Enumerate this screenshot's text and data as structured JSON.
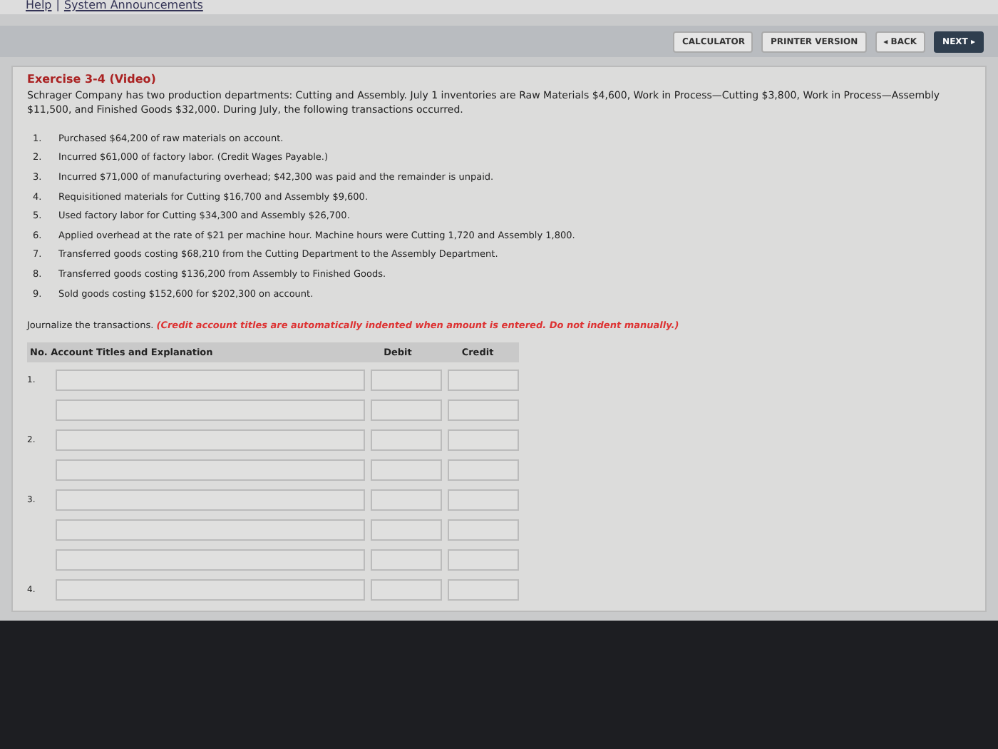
{
  "top_links": [
    "Help",
    "System Announcements"
  ],
  "top_links_separator": "|",
  "toolbar_buttons": [
    {
      "label": "CALCULATOR",
      "kind": "plain"
    },
    {
      "label": "PRINTER VERSION",
      "kind": "plain"
    },
    {
      "label": "◂ BACK",
      "kind": "plain"
    },
    {
      "label": "NEXT ▸",
      "kind": "primary"
    }
  ],
  "exercise": {
    "title": "Exercise 3-4 (Video)",
    "intro": "Schrager Company has two production departments: Cutting and Assembly. July 1 inventories are Raw Materials $4,600, Work in Process—Cutting $3,800, Work in Process—Assembly $11,500, and Finished Goods $32,000. During July, the following transactions occurred.",
    "transactions": [
      {
        "number": "1.",
        "text": "Purchased $64,200 of raw materials on account."
      },
      {
        "number": "2.",
        "text": "Incurred $61,000 of factory labor. (Credit Wages Payable.)"
      },
      {
        "number": "3.",
        "text": "Incurred $71,000 of manufacturing overhead; $42,300 was paid and the remainder is unpaid."
      },
      {
        "number": "4.",
        "text": "Requisitioned materials for Cutting $16,700 and Assembly $9,600."
      },
      {
        "number": "5.",
        "text": "Used factory labor for Cutting $34,300 and Assembly $26,700."
      },
      {
        "number": "6.",
        "text": "Applied overhead at the rate of $21 per machine hour. Machine hours were Cutting 1,720 and Assembly 1,800."
      },
      {
        "number": "7.",
        "text": "Transferred goods costing $68,210 from the Cutting Department to the Assembly Department."
      },
      {
        "number": "8.",
        "text": "Transferred goods costing $136,200 from Assembly to Finished Goods."
      },
      {
        "number": "9.",
        "text": "Sold goods costing $152,600 for $202,300 on account."
      }
    ],
    "instruction": "Journalize the transactions. *(Credit account titles are automatically indented when amount is entered. Do not indent manually.)*"
  },
  "journal": {
    "columns": [
      "No. Account Titles and Explanation",
      "Debit",
      "Credit"
    ],
    "rows": [
      {
        "number": "1."
      },
      {},
      {
        "number": "2."
      },
      {},
      {
        "number": "3."
      },
      {},
      {},
      {
        "number": "4."
      }
    ]
  }
}
